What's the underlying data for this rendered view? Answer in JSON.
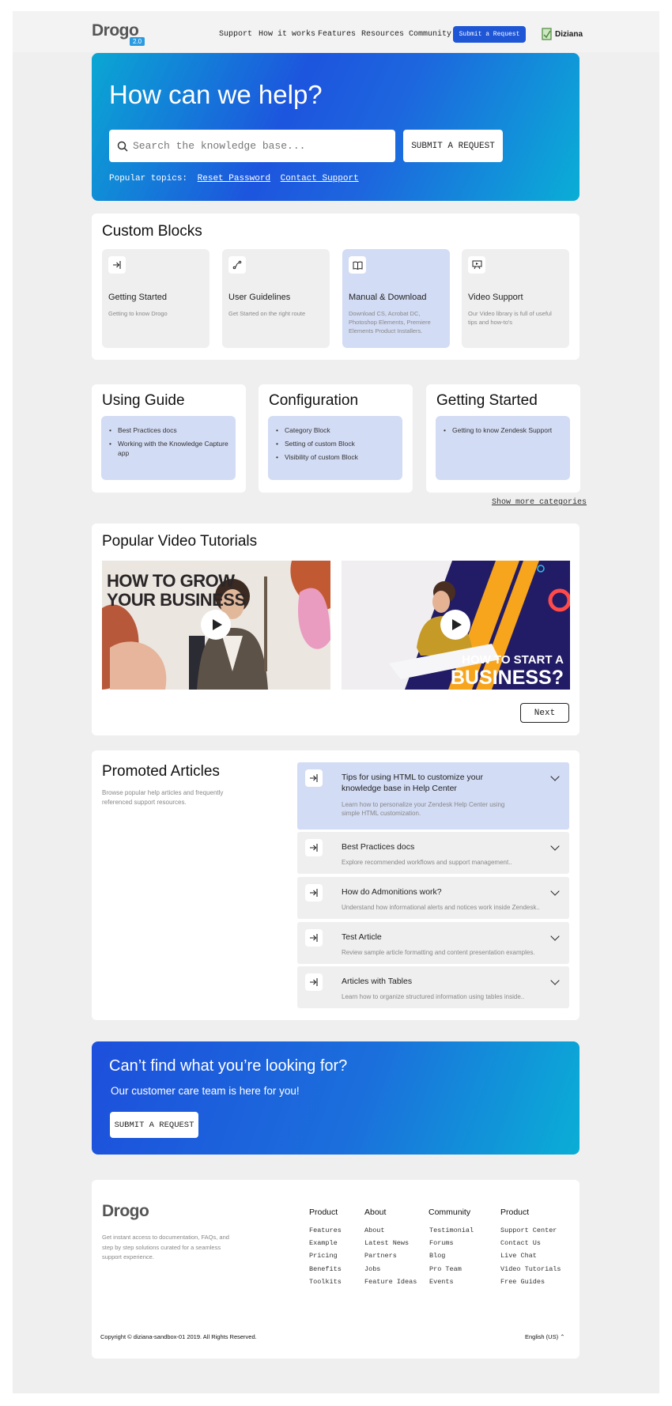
{
  "header": {
    "logo": "Drogo",
    "version": "2.0",
    "nav": [
      "Support",
      "How it works",
      "Features",
      "Resources",
      "Community"
    ],
    "submit_label": "Submit a Request",
    "user": "Diziana"
  },
  "hero": {
    "title": "How can we help?",
    "search_placeholder": "Search the knowledge base...",
    "button": "SUBMIT A REQUEST",
    "topics_label": "Popular topics:",
    "topics": [
      "Reset Password",
      "Contact Support"
    ]
  },
  "custom_blocks": {
    "title": "Custom Blocks",
    "items": [
      {
        "title": "Getting Started",
        "desc": "Getting to know Drogo",
        "icon": "sign-in-icon"
      },
      {
        "title": "User Guidelines",
        "desc": "Get Started on the right route",
        "icon": "route-icon"
      },
      {
        "title": "Manual & Download",
        "desc": "Download CS, Acrobat DC, Photoshop Elements, Premiere Elements Product Installers.",
        "icon": "book-icon"
      },
      {
        "title": "Video Support",
        "desc": "Our Video library is full of useful tips and how-to's",
        "icon": "video-icon"
      }
    ]
  },
  "categories": [
    {
      "title": "Using Guide",
      "items": [
        "Best Practices docs",
        "Working with the Knowledge Capture app"
      ]
    },
    {
      "title": "Configuration",
      "items": [
        "Category Block",
        "Setting of custom Block",
        "Visibility of custom Block"
      ]
    },
    {
      "title": "Getting Started",
      "items": [
        "Getting to know Zendesk Support"
      ]
    }
  ],
  "show_more": "Show more categories",
  "videos": {
    "title": "Popular Video Tutorials",
    "items": [
      {
        "caption": "HOW TO GROW YOUR BUSINESS",
        "line1": "HOW TO GROW",
        "line2": "YOUR BUSINESS"
      },
      {
        "caption": "HOW TO START A BUSINESS?",
        "line1": "HOW TO START A",
        "line2": "BUSINESS?"
      }
    ],
    "next": "Next"
  },
  "promoted": {
    "title": "Promoted Articles",
    "desc": "Browse popular help articles and frequently referenced support resources.",
    "articles": [
      {
        "title": "Tips for using HTML to customize your knowledge base in Help Center",
        "desc": "Learn how to personalize your Zendesk Help Center using simple HTML customization."
      },
      {
        "title": "Best Practices docs",
        "desc": "Explore recommended workflows and support management.."
      },
      {
        "title": "How do Admonitions work?",
        "desc": "Understand how informational alerts and notices work inside Zendesk.."
      },
      {
        "title": "Test Article",
        "desc": "Review sample article formatting and content presentation examples."
      },
      {
        "title": "Articles with Tables",
        "desc": "Learn how to organize structured information using tables inside.."
      }
    ]
  },
  "cta": {
    "title": "Can’t find what you’re looking for?",
    "subtitle": "Our customer care team is here for you!",
    "button": "SUBMIT A REQUEST"
  },
  "footer": {
    "logo": "Drogo",
    "desc": "Get instant access to documentation, FAQs, and step by step solutions curated for a seamless support experience.",
    "columns": [
      {
        "title": "Product",
        "links": [
          "Features",
          "Example",
          "Pricing",
          "Benefits",
          "Toolkits"
        ]
      },
      {
        "title": "About",
        "links": [
          "About",
          "Latest News",
          "Partners",
          "Jobs",
          "Feature Ideas"
        ]
      },
      {
        "title": "Community",
        "links": [
          "Testimonial",
          "Forums",
          "Blog",
          "Pro Team",
          "Events"
        ]
      },
      {
        "title": "Product",
        "links": [
          "Support Center",
          "Contact Us",
          "Live Chat",
          "Video Tutorials",
          "Free Guides"
        ]
      }
    ],
    "copyright": "Copyright © diziana-sandbox-01 2019. All Rights Reserved.",
    "language": "English (US)"
  }
}
